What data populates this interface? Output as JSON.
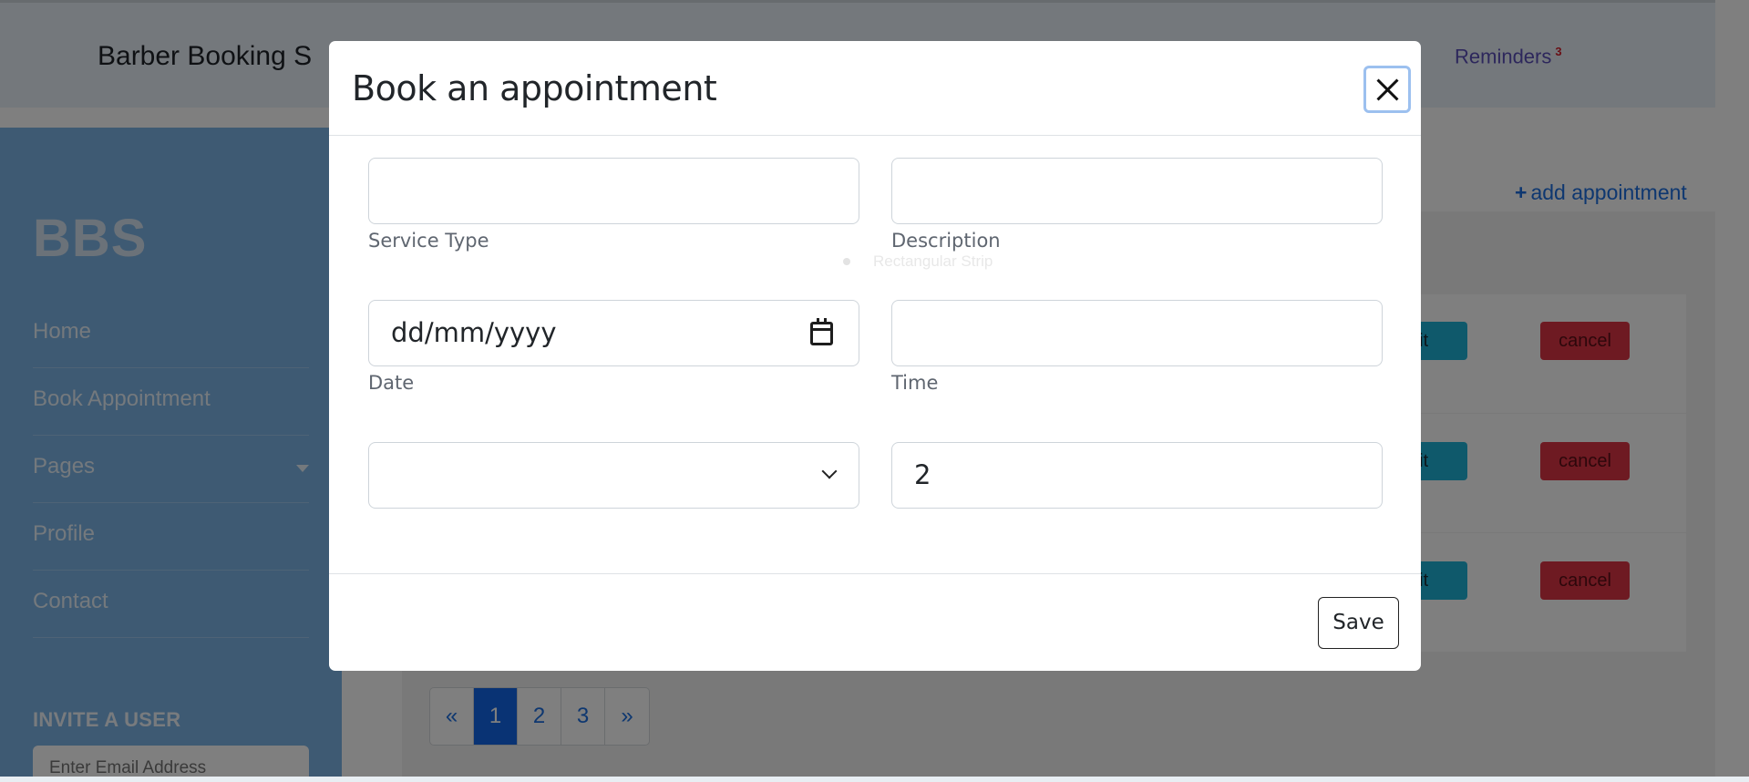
{
  "header": {
    "brand": "Barber Booking S",
    "reminders_label": "Reminders",
    "reminders_count": "3"
  },
  "sidebar": {
    "logo": "BBS",
    "items": [
      {
        "label": "Home"
      },
      {
        "label": "Book Appointment"
      },
      {
        "label": "Pages"
      },
      {
        "label": "Profile"
      },
      {
        "label": "Contact"
      }
    ],
    "invite_title": "INVITE A USER",
    "invite_placeholder": "Enter Email Address"
  },
  "main": {
    "add_appointment": "add appointment",
    "add_icon": "+",
    "cards": [
      {
        "edit": "dit",
        "cancel": "cancel"
      },
      {
        "edit": "dit",
        "cancel": "cancel"
      },
      {
        "edit": "dit",
        "cancel": "cancel"
      }
    ],
    "pagination": [
      "«",
      "1",
      "2",
      "3",
      "»"
    ],
    "active_page": "1"
  },
  "modal": {
    "title": "Book an appointment",
    "close_icon": "close-icon",
    "fields": {
      "service_type": {
        "label": "Service Type",
        "value": ""
      },
      "description": {
        "label": "Description",
        "value": ""
      },
      "date": {
        "label": "Date",
        "placeholder": "dd/mm/yyyy"
      },
      "time": {
        "label": "Time",
        "value": ""
      },
      "select": {
        "value": ""
      },
      "number": {
        "value": "2"
      }
    },
    "ghost_text": "Rectangular Strip",
    "save_label": "Save"
  }
}
